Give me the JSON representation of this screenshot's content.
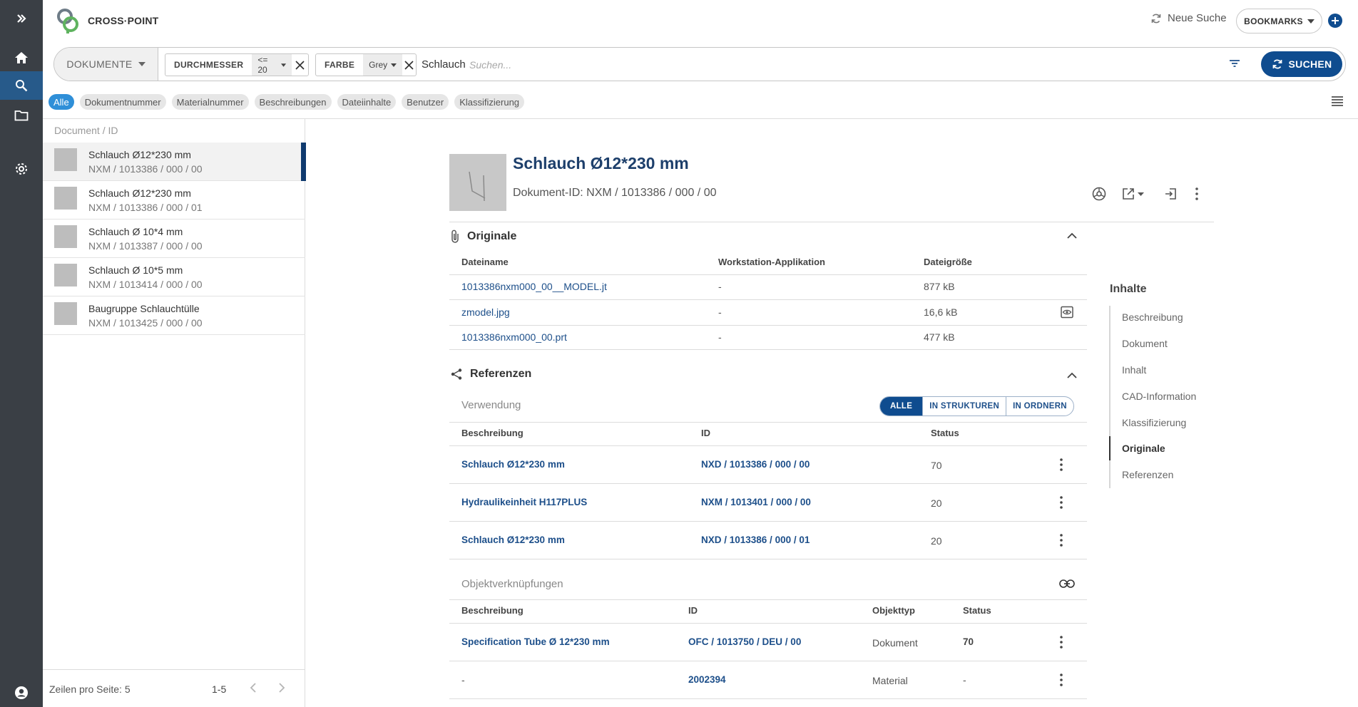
{
  "app": {
    "brand": "CROSS·POINT"
  },
  "header": {
    "new_search": "Neue Suche",
    "bookmarks": "BOOKMARKS"
  },
  "search": {
    "type_select": "DOKUMENTE",
    "chips": [
      {
        "label": "DURCHMESSER",
        "value": "<= 20"
      },
      {
        "label": "FARBE",
        "value": "Grey"
      }
    ],
    "query": "Schlauch",
    "placeholder": "Suchen...",
    "button": "SUCHEN"
  },
  "scopes": [
    "Alle",
    "Dokumentnummer",
    "Materialnummer",
    "Beschreibungen",
    "Dateiinhalte",
    "Benutzer",
    "Klassifizierung"
  ],
  "results": {
    "column": "Document / ID",
    "items": [
      {
        "title": "Schlauch Ø12*230 mm",
        "id": "NXM / 1013386 / 000 / 00"
      },
      {
        "title": "Schlauch Ø12*230 mm",
        "id": "NXM / 1013386 / 000 / 01"
      },
      {
        "title": "Schlauch Ø 10*4 mm",
        "id": "NXM / 1013387 / 000 / 00"
      },
      {
        "title": "Schlauch Ø 10*5 mm",
        "id": "NXM / 1013414 / 000 / 00"
      },
      {
        "title": "Baugruppe Schlauchtülle",
        "id": "NXM / 1013425 / 000 / 00"
      }
    ],
    "rows_per_page": "Zeilen pro Seite: 5",
    "range": "1-5"
  },
  "detail": {
    "title": "Schlauch Ø12*230 mm",
    "doc_id": "Dokument-ID: NXM / 1013386 / 000 / 00",
    "originale": {
      "title": "Originale",
      "headers": [
        "Dateiname",
        "Workstation-Applikation",
        "Dateigröße"
      ],
      "rows": [
        {
          "name": "1013386nxm000_00__MODEL.jt",
          "app": "-",
          "size": "877 kB"
        },
        {
          "name": "zmodel.jpg",
          "app": "-",
          "size": "16,6 kB"
        },
        {
          "name": "1013386nxm000_00.prt",
          "app": "-",
          "size": "477 kB"
        }
      ]
    },
    "referenzen": {
      "title": "Referenzen",
      "verwendung": "Verwendung",
      "filters": [
        "ALLE",
        "IN STRUKTUREN",
        "IN ORDNERN"
      ],
      "headers": [
        "Beschreibung",
        "ID",
        "Status"
      ],
      "rows": [
        {
          "desc": "Schlauch Ø12*230 mm",
          "id": "NXD / 1013386 / 000 / 00",
          "status": "70"
        },
        {
          "desc": "Hydraulikeinheit H117PLUS",
          "id": "NXM / 1013401 / 000 / 00",
          "status": "20"
        },
        {
          "desc": "Schlauch Ø12*230 mm",
          "id": "NXD / 1013386 / 000 / 01",
          "status": "20"
        }
      ],
      "links_title": "Objektverknüpfungen",
      "links_headers": [
        "Beschreibung",
        "ID",
        "Objekttyp",
        "Status"
      ],
      "links": [
        {
          "desc": "Specification Tube Ø 12*230 mm",
          "id": "OFC / 1013750 / DEU / 00",
          "type": "Dokument",
          "status": "70"
        },
        {
          "desc": "-",
          "id": "2002394",
          "type": "Material",
          "status": "-"
        }
      ]
    }
  },
  "toc": {
    "title": "Inhalte",
    "items": [
      "Beschreibung",
      "Dokument",
      "Inhalt",
      "CAD-Information",
      "Klassifizierung",
      "Originale",
      "Referenzen"
    ]
  },
  "colors": {
    "primary": "#0f4c8f",
    "rail": "#3a3f45",
    "scope_active": "#2f8fd8"
  }
}
